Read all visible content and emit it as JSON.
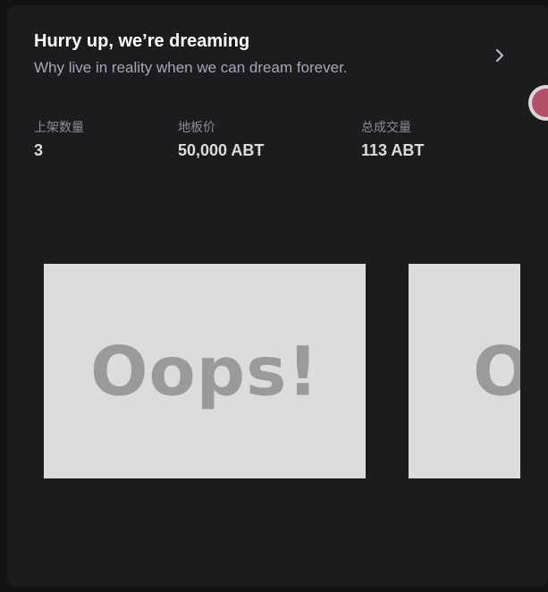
{
  "collection": {
    "title": "Hurry up, we’re dreaming",
    "subtitle": "Why live in reality when we can dream forever."
  },
  "stats": [
    {
      "label": "上架数量",
      "value": "3"
    },
    {
      "label": "地板价",
      "value": "50,000 ABT"
    },
    {
      "label": "总成交量",
      "value": "113 ABT"
    }
  ],
  "thumbnails": [
    {
      "text": "Oops!"
    },
    {
      "text": "Oops!"
    }
  ],
  "icons": {
    "chevron": "chevron-right-icon"
  },
  "colors": {
    "background": "#131315",
    "card": "#1c1c1e",
    "title": "#ffffff",
    "subtitle": "#a7a6b6",
    "placeholder": "#dcdcdc",
    "placeholder_text": "#9a9a9a",
    "avatar": "#b3506a"
  }
}
